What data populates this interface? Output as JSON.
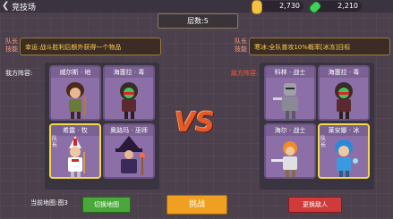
{
  "header": {
    "back_icon": "chevron-left-icon",
    "title": "竞技场"
  },
  "currency": {
    "gold": "2,730",
    "gem": "2,210",
    "gold_color": "#f5c342",
    "gem_color": "#3fd35a"
  },
  "floor": "层数:5",
  "left_skill": {
    "label": "队长技能",
    "text": "幸运:战斗胜利后额外获得一个物品"
  },
  "right_skill": {
    "label": "队长技能",
    "text": "寒冰:全队普攻10%概率[冰冻]目标"
  },
  "my_team": {
    "label": "我方阵容:",
    "label_color": "#ffffff",
    "cards": [
      {
        "name": "威尔斯 · 地",
        "leader": false
      },
      {
        "name": "海塞拉 · 毒",
        "leader": false
      },
      {
        "name": "希露 · 牧",
        "leader": true,
        "leader_tag": "队长"
      },
      {
        "name": "奥路玛 · 巫师",
        "leader": false
      }
    ]
  },
  "enemy_team": {
    "label": "敌方阵容:",
    "label_color": "#ff5a3a",
    "cards": [
      {
        "name": "科林 · 战士",
        "leader": false
      },
      {
        "name": "海塞拉 · 毒",
        "leader": false
      },
      {
        "name": "海尔 · 战士",
        "leader": false
      },
      {
        "name": "莱安娜 · 冰",
        "leader": true,
        "leader_tag": "队长"
      }
    ]
  },
  "vs_text": "VS",
  "map": {
    "label": "当前地图:",
    "value": "图3"
  },
  "buttons": {
    "switch_map": "切换地图",
    "challenge": "挑战",
    "change_enemy": "更换敌人"
  }
}
